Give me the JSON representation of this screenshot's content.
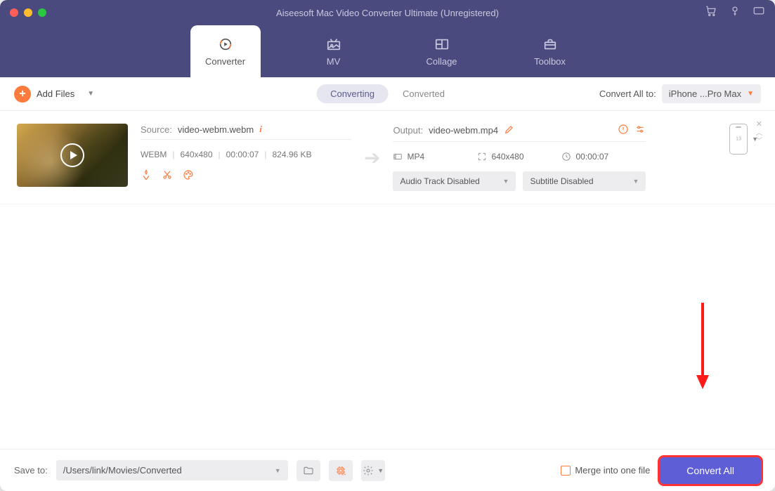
{
  "window": {
    "title": "Aiseesoft Mac Video Converter Ultimate (Unregistered)"
  },
  "nav": {
    "items": [
      {
        "label": "Converter"
      },
      {
        "label": "MV"
      },
      {
        "label": "Collage"
      },
      {
        "label": "Toolbox"
      }
    ]
  },
  "toolbar": {
    "add_files": "Add Files",
    "tabs": {
      "converting": "Converting",
      "converted": "Converted"
    },
    "convert_all_to_label": "Convert All to:",
    "convert_all_target": "iPhone ...Pro Max"
  },
  "item": {
    "source_label": "Source:",
    "source_name": "video-webm.webm",
    "src_format": "WEBM",
    "src_res": "640x480",
    "src_dur": "00:00:07",
    "src_size": "824.96 KB",
    "output_label": "Output:",
    "output_name": "video-webm.mp4",
    "out_format": "MP4",
    "out_res": "640x480",
    "out_dur": "00:00:07",
    "audio_track": "Audio Track Disabled",
    "subtitle": "Subtitle Disabled"
  },
  "footer": {
    "save_to_label": "Save to:",
    "save_path": "/Users/link/Movies/Converted",
    "merge_label": "Merge into one file",
    "convert_all": "Convert All"
  }
}
